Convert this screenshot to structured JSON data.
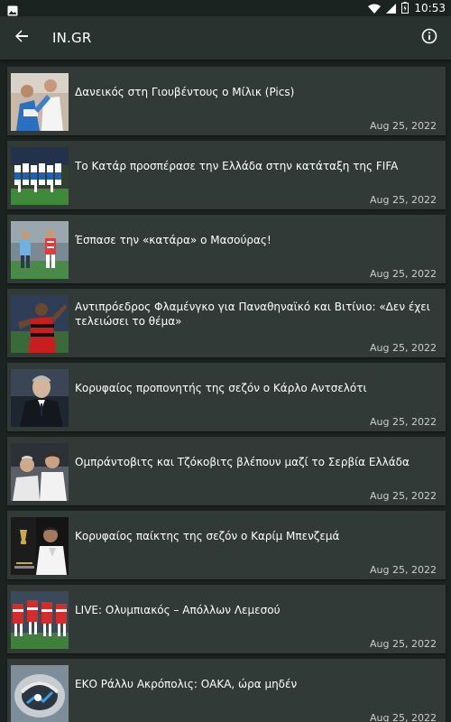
{
  "status_bar": {
    "time": "10:53",
    "icons": [
      "image-icon",
      "wifi-icon",
      "signal-icon",
      "battery-icon"
    ]
  },
  "app_bar": {
    "title": "IN.GR",
    "back_icon": "arrow-back-icon",
    "info_icon": "info-icon"
  },
  "colors": {
    "background": "#1b2320",
    "app_bar": "#2a3230",
    "card": "#323a38",
    "date_text": "#c9cfcd"
  },
  "articles": [
    {
      "title": "Δανεικός στη Γιουβέντους ο Μίλικ (Pics)",
      "date": "Aug 25, 2022"
    },
    {
      "title": "Το Κατάρ προσπέρασε την Ελλάδα στην κατάταξη της FIFA",
      "date": "Aug 25, 2022"
    },
    {
      "title": "Έσπασε την «κατάρα» ο Μασούρας!",
      "date": "Aug 25, 2022"
    },
    {
      "title": "Αντιπρόεδρος Φλαμένγκο για Παναθηναϊκό και Βιτίνιο: «Δεν έχει τελειώσει το θέμα»",
      "date": "Aug 25, 2022"
    },
    {
      "title": "Κορυφαίος προπονητής της σεζόν ο Κάρλο Αντσελότι",
      "date": "Aug 25, 2022"
    },
    {
      "title": "Ομπράντοβιτς και Τζόκοβιτς βλέπουν μαζί το Σερβία Ελλάδα",
      "date": "Aug 25, 2022"
    },
    {
      "title": "Κορυφαίος παίκτης της σεζόν ο Καρίμ Μπενζεμά",
      "date": "Aug 25, 2022"
    },
    {
      "title": "LIVE: Ολυμπιακός – Απόλλων Λεμεσού",
      "date": "Aug 25, 2022"
    },
    {
      "title": "ΕΚΟ Ράλλυ Ακρόπολις: ΟΑΚΑ, ώρα μηδέν",
      "date": "Aug 25, 2022"
    }
  ]
}
